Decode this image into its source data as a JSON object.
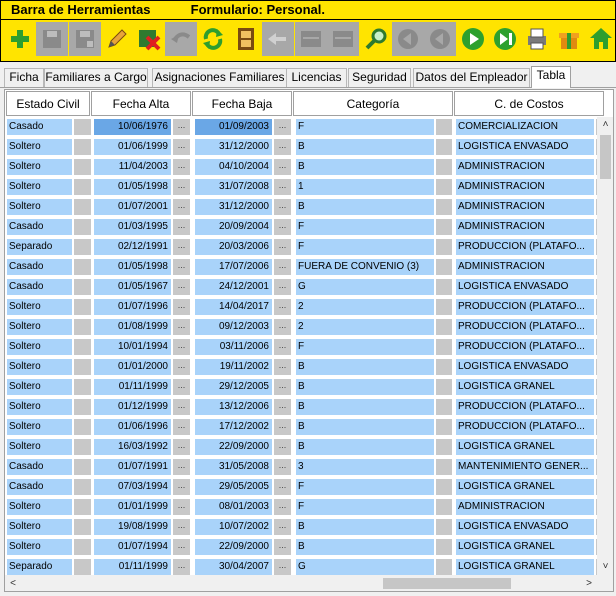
{
  "window": {
    "toolbar_name": "Barra de Herramientas",
    "form_title": "Formulario: Personal."
  },
  "toolbar": {
    "buttons": [
      {
        "name": "add-icon",
        "enabled": true
      },
      {
        "name": "save-icon",
        "enabled": false
      },
      {
        "name": "save-as-icon",
        "enabled": false
      },
      {
        "name": "edit-pencil-icon",
        "enabled": true
      },
      {
        "name": "delete-icon",
        "enabled": true
      },
      {
        "name": "undo-icon",
        "enabled": false
      },
      {
        "name": "refresh-icon",
        "enabled": true
      },
      {
        "name": "film-icon",
        "enabled": true
      },
      {
        "name": "back-arrow-icon",
        "enabled": false
      },
      {
        "name": "panel-icon",
        "enabled": false
      },
      {
        "name": "panel-icon",
        "enabled": false
      },
      {
        "name": "search-icon",
        "enabled": true
      },
      {
        "name": "first-record-icon",
        "enabled": false
      },
      {
        "name": "previous-record-icon",
        "enabled": false
      },
      {
        "name": "next-record-icon",
        "enabled": true
      },
      {
        "name": "last-record-icon",
        "enabled": true
      },
      {
        "name": "printer-icon",
        "enabled": true
      },
      {
        "name": "gift-icon",
        "enabled": true
      },
      {
        "name": "home-icon",
        "enabled": true
      }
    ]
  },
  "tabs": [
    {
      "label": "Ficha",
      "active": false
    },
    {
      "label": "Familiares a Cargo",
      "active": false
    },
    {
      "label": "Asignaciones Familiares",
      "active": false
    },
    {
      "label": "Licencias",
      "active": false
    },
    {
      "label": "Seguridad",
      "active": false
    },
    {
      "label": "Datos del Empleador",
      "active": false
    },
    {
      "label": "Tabla",
      "active": true
    }
  ],
  "columns": [
    "Estado Civil",
    "Fecha Alta",
    "Fecha Baja",
    "Categoría",
    "C. de Costos"
  ],
  "ellipsis": "...",
  "rows": [
    {
      "estado": "Casado",
      "alta": "10/06/1976",
      "baja": "01/09/2003",
      "categoria": "F",
      "costos": "COMERCIALIZACION"
    },
    {
      "estado": "Soltero",
      "alta": "01/06/1999",
      "baja": "31/12/2000",
      "categoria": "B",
      "costos": "LOGISTICA ENVASADO"
    },
    {
      "estado": "Soltero",
      "alta": "11/04/2003",
      "baja": "04/10/2004",
      "categoria": "B",
      "costos": "ADMINISTRACION"
    },
    {
      "estado": "Soltero",
      "alta": "01/05/1998",
      "baja": "31/07/2008",
      "categoria": "1",
      "costos": "ADMINISTRACION"
    },
    {
      "estado": "Soltero",
      "alta": "01/07/2001",
      "baja": "31/12/2000",
      "categoria": "B",
      "costos": "ADMINISTRACION"
    },
    {
      "estado": "Casado",
      "alta": "01/03/1995",
      "baja": "20/09/2004",
      "categoria": "F",
      "costos": "ADMINISTRACION"
    },
    {
      "estado": "Separado",
      "alta": "02/12/1991",
      "baja": "20/03/2006",
      "categoria": "F",
      "costos": "PRODUCCION (PLATAFO..."
    },
    {
      "estado": "Casado",
      "alta": "01/05/1998",
      "baja": "17/07/2006",
      "categoria": "FUERA DE CONVENIO (3)",
      "costos": "ADMINISTRACION"
    },
    {
      "estado": "Casado",
      "alta": "01/05/1967",
      "baja": "24/12/2001",
      "categoria": "G",
      "costos": "LOGISTICA ENVASADO"
    },
    {
      "estado": "Soltero",
      "alta": "01/07/1996",
      "baja": "14/04/2017",
      "categoria": "2",
      "costos": "PRODUCCION (PLATAFO..."
    },
    {
      "estado": "Soltero",
      "alta": "01/08/1999",
      "baja": "09/12/2003",
      "categoria": "2",
      "costos": "PRODUCCION (PLATAFO..."
    },
    {
      "estado": "Soltero",
      "alta": "10/01/1994",
      "baja": "03/11/2006",
      "categoria": "F",
      "costos": "PRODUCCION (PLATAFO..."
    },
    {
      "estado": "Soltero",
      "alta": "01/01/2000",
      "baja": "19/11/2002",
      "categoria": "B",
      "costos": "LOGISTICA ENVASADO"
    },
    {
      "estado": "Soltero",
      "alta": "01/11/1999",
      "baja": "29/12/2005",
      "categoria": "B",
      "costos": "LOGISTICA GRANEL"
    },
    {
      "estado": "Soltero",
      "alta": "01/12/1999",
      "baja": "13/12/2006",
      "categoria": "B",
      "costos": "PRODUCCION (PLATAFO..."
    },
    {
      "estado": "Soltero",
      "alta": "01/06/1996",
      "baja": "17/12/2002",
      "categoria": "B",
      "costos": "PRODUCCION (PLATAFO..."
    },
    {
      "estado": "Soltero",
      "alta": "16/03/1992",
      "baja": "22/09/2000",
      "categoria": "B",
      "costos": "LOGISTICA GRANEL"
    },
    {
      "estado": "Casado",
      "alta": "01/07/1991",
      "baja": "31/05/2008",
      "categoria": "3",
      "costos": "MANTENIMIENTO GENER..."
    },
    {
      "estado": "Casado",
      "alta": "07/03/1994",
      "baja": "29/05/2005",
      "categoria": "F",
      "costos": "LOGISTICA GRANEL"
    },
    {
      "estado": "Soltero",
      "alta": "01/01/1999",
      "baja": "08/01/2003",
      "categoria": "F",
      "costos": "ADMINISTRACION"
    },
    {
      "estado": "Soltero",
      "alta": "19/08/1999",
      "baja": "10/07/2002",
      "categoria": "B",
      "costos": "LOGISTICA ENVASADO"
    },
    {
      "estado": "Soltero",
      "alta": "01/07/1994",
      "baja": "22/09/2000",
      "categoria": "B",
      "costos": "LOGISTICA GRANEL"
    },
    {
      "estado": "Separado",
      "alta": "01/11/1999",
      "baja": "30/04/2007",
      "categoria": "G",
      "costos": "LOGISTICA GRANEL"
    }
  ],
  "scrollbar": {
    "up": "˄",
    "down": "˅",
    "left": "<",
    "right": ">"
  },
  "colors": {
    "toolbar_bg": "#ffe400",
    "cell_bg": "#a9d3fa",
    "selected_cell_bg": "#6aa7e6"
  }
}
